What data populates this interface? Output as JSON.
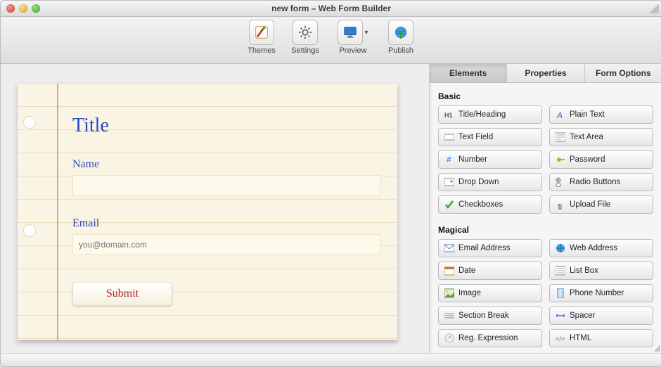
{
  "window": {
    "title": "new form – Web Form Builder"
  },
  "toolbar": {
    "items": [
      {
        "id": "themes",
        "label": "Themes"
      },
      {
        "id": "settings",
        "label": "Settings"
      },
      {
        "id": "preview",
        "label": "Preview"
      },
      {
        "id": "publish",
        "label": "Publish"
      }
    ]
  },
  "sidepanel": {
    "tabs": [
      {
        "id": "elements",
        "label": "Elements",
        "active": true
      },
      {
        "id": "properties",
        "label": "Properties",
        "active": false
      },
      {
        "id": "form-options",
        "label": "Form Options",
        "active": false
      }
    ],
    "groups": [
      {
        "title": "Basic",
        "items": [
          {
            "id": "heading",
            "label": "Title/Heading",
            "icon": "h1-icon"
          },
          {
            "id": "plain-text",
            "label": "Plain Text",
            "icon": "text-icon"
          },
          {
            "id": "text-field",
            "label": "Text Field",
            "icon": "textfield-icon"
          },
          {
            "id": "text-area",
            "label": "Text Area",
            "icon": "textarea-icon"
          },
          {
            "id": "number",
            "label": "Number",
            "icon": "number-icon"
          },
          {
            "id": "password",
            "label": "Password",
            "icon": "key-icon"
          },
          {
            "id": "dropdown",
            "label": "Drop Down",
            "icon": "dropdown-icon"
          },
          {
            "id": "radios",
            "label": "Radio Buttons",
            "icon": "radio-icon"
          },
          {
            "id": "checkboxes",
            "label": "Checkboxes",
            "icon": "check-icon"
          },
          {
            "id": "upload",
            "label": "Upload File",
            "icon": "paperclip-icon"
          }
        ]
      },
      {
        "title": "Magical",
        "items": [
          {
            "id": "email",
            "label": "Email Address",
            "icon": "email-icon"
          },
          {
            "id": "web",
            "label": "Web Address",
            "icon": "globe-icon"
          },
          {
            "id": "date",
            "label": "Date",
            "icon": "calendar-icon"
          },
          {
            "id": "listbox",
            "label": "List Box",
            "icon": "listbox-icon"
          },
          {
            "id": "image",
            "label": "Image",
            "icon": "image-icon"
          },
          {
            "id": "phone",
            "label": "Phone Number",
            "icon": "phone-icon"
          },
          {
            "id": "section",
            "label": "Section Break",
            "icon": "section-icon"
          },
          {
            "id": "spacer",
            "label": "Spacer",
            "icon": "spacer-icon"
          },
          {
            "id": "regex",
            "label": "Reg. Expression",
            "icon": "regex-icon"
          },
          {
            "id": "html",
            "label": "HTML",
            "icon": "html-icon"
          }
        ]
      }
    ]
  },
  "form": {
    "title": "Title",
    "fields": [
      {
        "id": "name",
        "label": "Name",
        "placeholder": "",
        "type": "text"
      },
      {
        "id": "email",
        "label": "Email",
        "placeholder": "you@domain.com",
        "type": "email"
      }
    ],
    "submit_label": "Submit"
  }
}
